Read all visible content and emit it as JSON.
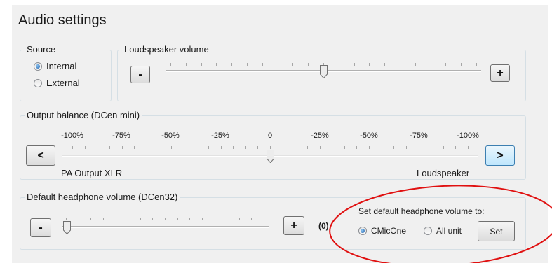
{
  "title": "Audio settings",
  "source": {
    "label": "Source",
    "options": [
      {
        "label": "Internal",
        "checked": true
      },
      {
        "label": "External",
        "checked": false
      }
    ]
  },
  "loudspeaker": {
    "label": "Loudspeaker volume",
    "minus": "-",
    "plus": "+",
    "value_fraction": 0.5
  },
  "balance": {
    "label": "Output balance (DCen mini)",
    "left_button": "<",
    "right_button": ">",
    "scale": [
      "-100%",
      "-75%",
      "-50%",
      "-25%",
      "0",
      "-25%",
      "-50%",
      "-75%",
      "-100%"
    ],
    "left_label": "PA Output XLR",
    "right_label": "Loudspeaker",
    "value_fraction": 0.5
  },
  "headphone": {
    "label": "Default headphone volume (DCen32)",
    "minus": "-",
    "plus": "+",
    "value_display": "(0)",
    "value_fraction": 0.0,
    "set_default_label": "Set default headphone volume to:",
    "options": [
      {
        "label": "CMicOne",
        "checked": true
      },
      {
        "label": "All unit",
        "checked": false
      }
    ],
    "set_button": "Set"
  },
  "annotation_color": "#e01010"
}
